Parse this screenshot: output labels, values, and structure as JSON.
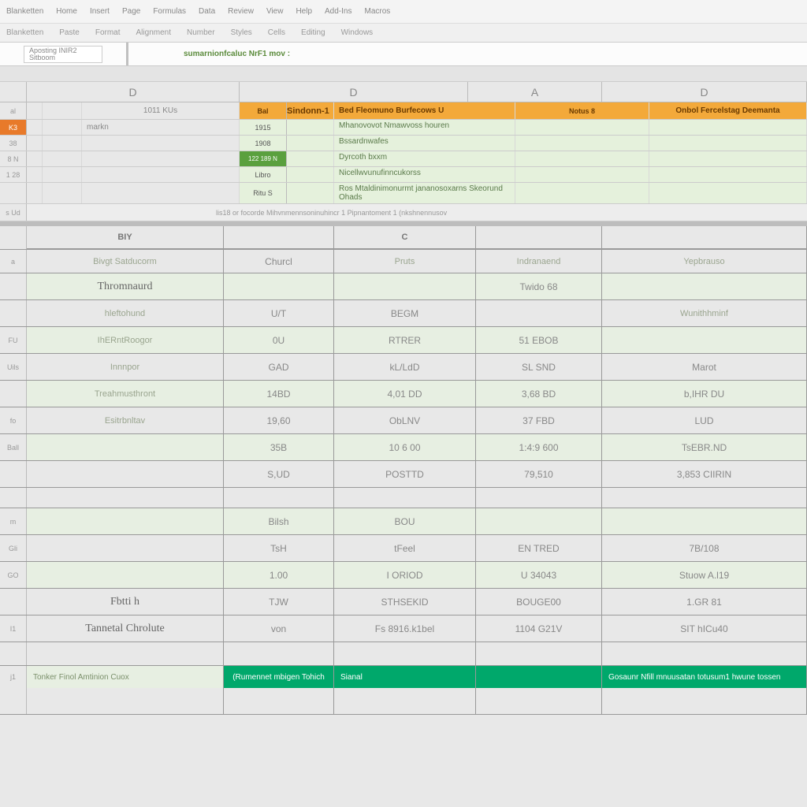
{
  "menubar": [
    "Blanketten",
    "Home",
    "Insert",
    "Page",
    "Formulas",
    "Data",
    "Review",
    "View",
    "Help",
    "Add-Ins",
    "Macros"
  ],
  "ribbon": [
    "Blanketten",
    "Paste",
    "Format",
    "Alignment",
    "Number",
    "Styles",
    "Cells",
    "Editing",
    "Windows"
  ],
  "name_box": {
    "line1": "Aposting INIR2",
    "line2": "Sitboom"
  },
  "formula_bar": "sumarnionfcaluc NrF1 mov :",
  "col_headers": {
    "d1": "D",
    "d2": "D",
    "a": "A",
    "d3": "D"
  },
  "top_rows": {
    "r1_c3": "1011 KUs",
    "r1_c4": "Bal",
    "r2_c3": "markn",
    "r2_c4": "1915",
    "r3_c4": "1908",
    "r4_c4": "122 189 N",
    "r5_c4": "Libro",
    "r6_c4": "Ritu S",
    "footer": "lis18  or focorde  Mihvnmennsoninuhincr 1  Pipnantoment 1  (nkshnennusov"
  },
  "orange_header": {
    "left": "Sindonn-1",
    "mid": "Bed Fleomuno Burfecows U",
    "right_a": "Notus 8",
    "right_d": "Onbol Fercelstag Deemanta"
  },
  "green_lines": [
    "Mhanovovot Nmawvoss houren",
    "Bssardnwafes",
    "Dyrcoth bxxm",
    "Nicellwvunufinncukorss",
    "Ros Mtaldinimonurmt jananosoxarns Skeorund Ohads"
  ],
  "cat_header": {
    "c1": "BIY",
    "c2": "",
    "c3": "C",
    "c4": "",
    "c5": ""
  },
  "subheader": {
    "c1": "Bivgt Satducorm",
    "c2": "Churcl",
    "c3": "Pruts",
    "c4": "Indranaend",
    "c5": "Yepbrauso"
  },
  "table": [
    {
      "c1": "Thromnaurd",
      "c2": "",
      "c3": "",
      "c4": "Twido 68",
      "c5": ""
    },
    {
      "c1": "hleftohund",
      "c2": "U/T",
      "c3": "BEGM",
      "c4": "",
      "c5": "Wunithhminf"
    },
    {
      "c1": "IhERntRoogor",
      "c2": "0U",
      "c3": "RTRER",
      "c4": "51 EBOB",
      "c5": ""
    },
    {
      "c1": "Innnpor",
      "c2": "GAD",
      "c3": "kL/LdD",
      "c4": "SL SND",
      "c5": "Marot"
    },
    {
      "c1": "Treahmusthront",
      "c2": "14BD",
      "c3": "4,01 DD",
      "c4": "3,68 BD",
      "c5": "b,IHR DU"
    },
    {
      "c1": "Esitrbnltav",
      "c2": "19,60",
      "c3": "ObLNV",
      "c4": "37 FBD",
      "c5": "LUD"
    },
    {
      "c1": "",
      "c2": "35B",
      "c3": "10 6 00",
      "c4": "1:4:9 600",
      "c5": "TsEBR.ND"
    },
    {
      "c1": "",
      "c2": "S,UD",
      "c3": "POSTTD",
      "c4": "79,510",
      "c5": "3,853 CIIRIN"
    },
    {
      "c1": "",
      "c2": "",
      "c3": "",
      "c4": "",
      "c5": ""
    },
    {
      "c1": "",
      "c2": "Bilsh",
      "c3": "BOU",
      "c4": "",
      "c5": ""
    },
    {
      "c1": "",
      "c2": "TsH",
      "c3": "tFeel",
      "c4": "EN TRED",
      "c5": "7B/108"
    },
    {
      "c1": "",
      "c2": "1.00",
      "c3": "I ORIOD",
      "c4": "U 34043",
      "c5": "Stuow  A.l19"
    },
    {
      "c1": "Fbtti h",
      "c2": "TJW",
      "c3": "STHSEKID",
      "c4": "BOUGE00",
      "c5": "1.GR 81"
    },
    {
      "c1": "Tannetal Chrolute",
      "c2": "von",
      "c3": "Fs 8916.k1bel",
      "c4": "1104 G21V",
      "c5": "SIT hICu40"
    }
  ],
  "summary": {
    "label": "Tonker Finol Amtinion Cuox",
    "band_a": "(Rumennet mbigen Tohich",
    "band_b": "Sianal",
    "band_c": "Gosaunr Nfill mnuusatan totusum1 hwune tossen"
  }
}
